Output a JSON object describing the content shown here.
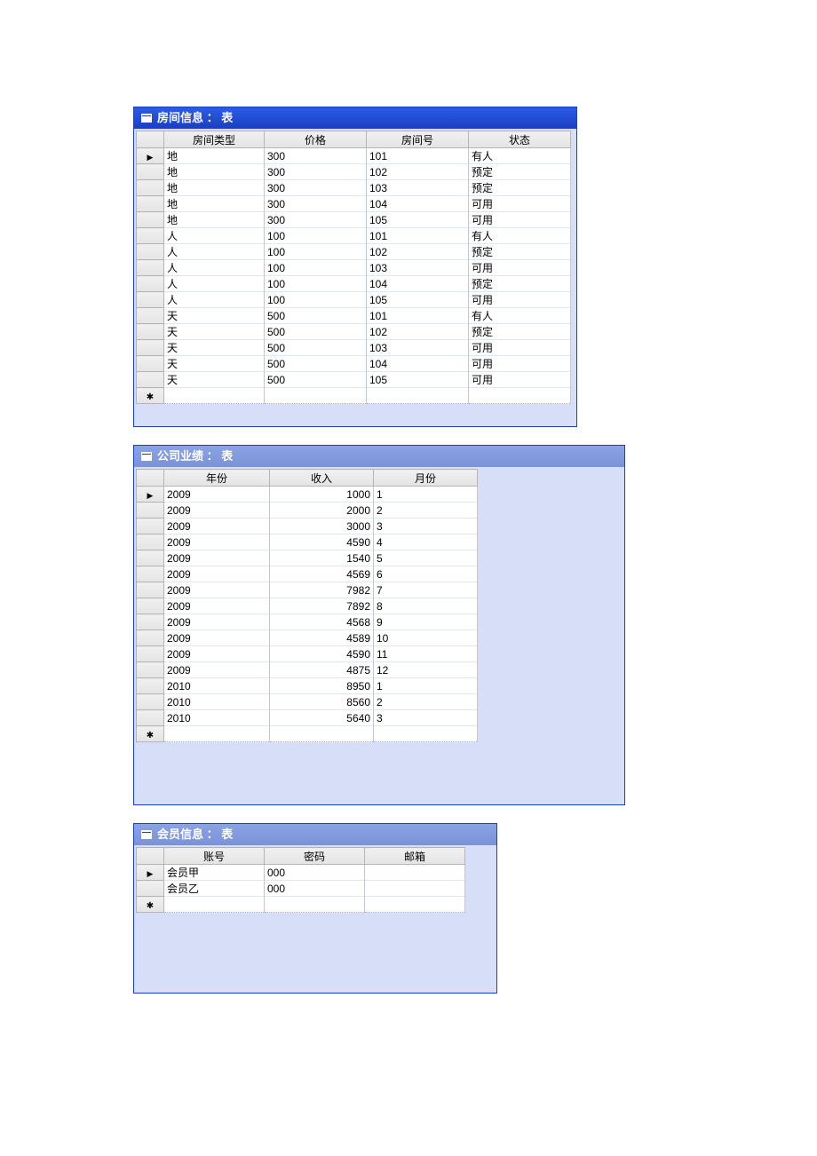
{
  "windows": {
    "rooms": {
      "title": "房间信息 ： 表",
      "columns": [
        "房间类型",
        "价格",
        "房间号",
        "状态"
      ],
      "rows": [
        {
          "type": "地",
          "price": "300",
          "no": "101",
          "status": "有人"
        },
        {
          "type": "地",
          "price": "300",
          "no": "102",
          "status": "预定"
        },
        {
          "type": "地",
          "price": "300",
          "no": "103",
          "status": "预定"
        },
        {
          "type": "地",
          "price": "300",
          "no": "104",
          "status": "可用"
        },
        {
          "type": "地",
          "price": "300",
          "no": "105",
          "status": "可用"
        },
        {
          "type": "人",
          "price": "100",
          "no": "101",
          "status": "有人"
        },
        {
          "type": "人",
          "price": "100",
          "no": "102",
          "status": "预定"
        },
        {
          "type": "人",
          "price": "100",
          "no": "103",
          "status": "可用"
        },
        {
          "type": "人",
          "price": "100",
          "no": "104",
          "status": "预定"
        },
        {
          "type": "人",
          "price": "100",
          "no": "105",
          "status": "可用"
        },
        {
          "type": "天",
          "price": "500",
          "no": "101",
          "status": "有人"
        },
        {
          "type": "天",
          "price": "500",
          "no": "102",
          "status": "预定"
        },
        {
          "type": "天",
          "price": "500",
          "no": "103",
          "status": "可用"
        },
        {
          "type": "天",
          "price": "500",
          "no": "104",
          "status": "可用"
        },
        {
          "type": "天",
          "price": "500",
          "no": "105",
          "status": "可用"
        }
      ]
    },
    "perf": {
      "title": "公司业绩 ： 表",
      "columns": [
        "年份",
        "收入",
        "月份"
      ],
      "rows": [
        {
          "y": "2009",
          "inc": "1000",
          "m": "1"
        },
        {
          "y": "2009",
          "inc": "2000",
          "m": "2"
        },
        {
          "y": "2009",
          "inc": "3000",
          "m": "3"
        },
        {
          "y": "2009",
          "inc": "4590",
          "m": "4"
        },
        {
          "y": "2009",
          "inc": "1540",
          "m": "5"
        },
        {
          "y": "2009",
          "inc": "4569",
          "m": "6"
        },
        {
          "y": "2009",
          "inc": "7982",
          "m": "7"
        },
        {
          "y": "2009",
          "inc": "7892",
          "m": "8"
        },
        {
          "y": "2009",
          "inc": "4568",
          "m": "9"
        },
        {
          "y": "2009",
          "inc": "4589",
          "m": "10"
        },
        {
          "y": "2009",
          "inc": "4590",
          "m": "11"
        },
        {
          "y": "2009",
          "inc": "4875",
          "m": "12"
        },
        {
          "y": "2010",
          "inc": "8950",
          "m": "1"
        },
        {
          "y": "2010",
          "inc": "8560",
          "m": "2"
        },
        {
          "y": "2010",
          "inc": "5640",
          "m": "3"
        }
      ]
    },
    "members": {
      "title": "会员信息 ： 表",
      "columns": [
        "账号",
        "密码",
        "邮箱"
      ],
      "rows": [
        {
          "acc": "会员甲",
          "pw": "000",
          "em": ""
        },
        {
          "acc": "会员乙",
          "pw": "000",
          "em": ""
        }
      ]
    }
  }
}
